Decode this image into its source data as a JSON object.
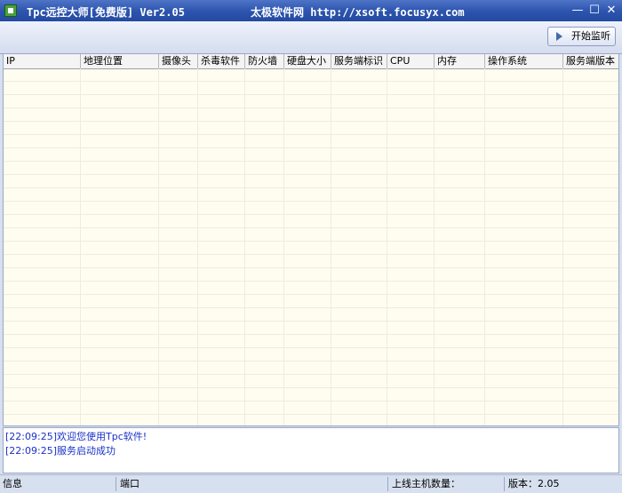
{
  "window": {
    "title": "Tpc远控大师[免费版] Ver2.05",
    "site": "太极软件网 http://xsoft.focusyx.com",
    "min": "—",
    "max": "☐",
    "close": "✕"
  },
  "toolbar": {
    "monitor_label": "开始监听"
  },
  "grid": {
    "columns": [
      "IP",
      "地理位置",
      "摄像头",
      "杀毒软件",
      "防火墙",
      "硬盘大小",
      "服务端标识",
      "CPU",
      "内存",
      "操作系统",
      "服务端版本"
    ],
    "rows": []
  },
  "log": {
    "lines": [
      "[22:09:25]欢迎您使用Tpc软件!",
      "[22:09:25]服务启动成功"
    ]
  },
  "status": {
    "info_label": "信息",
    "port_label": "端口",
    "hosts_label": "上线主机数量：",
    "version_label": "版本：2.05"
  }
}
